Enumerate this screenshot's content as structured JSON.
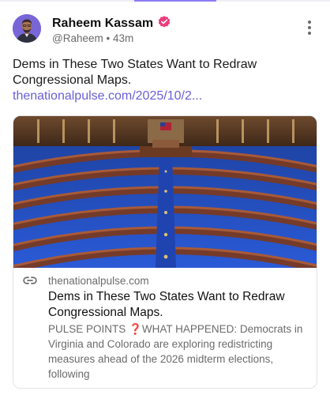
{
  "post": {
    "author_name": "Raheem Kassam",
    "handle": "@Raheem",
    "separator": "•",
    "time_ago": "43m",
    "verified_icon": "verified-badge-icon",
    "text": "Dems in These Two States Want to Redraw Congressional Maps.",
    "link_text": "thenationalpulse.com/2025/10/2...",
    "more_icon": "more-vertical-icon"
  },
  "link_card": {
    "image_alt": "House of Representatives chamber",
    "domain": "thenationalpulse.com",
    "title": "Dems in These Two States Want to Redraw Congressional Maps.",
    "description": "PULSE POINTS ❓WHAT HAPPENED: Democrats in Virginia and Colorado are exploring redistricting measures ahead of the 2026 midterm elections, following",
    "link_icon": "link-icon"
  },
  "colors": {
    "accent": "#8b7cf6",
    "link": "#6b5fd6",
    "verified_badge": "#ec3b7c",
    "muted_text": "#6b6b6b"
  }
}
